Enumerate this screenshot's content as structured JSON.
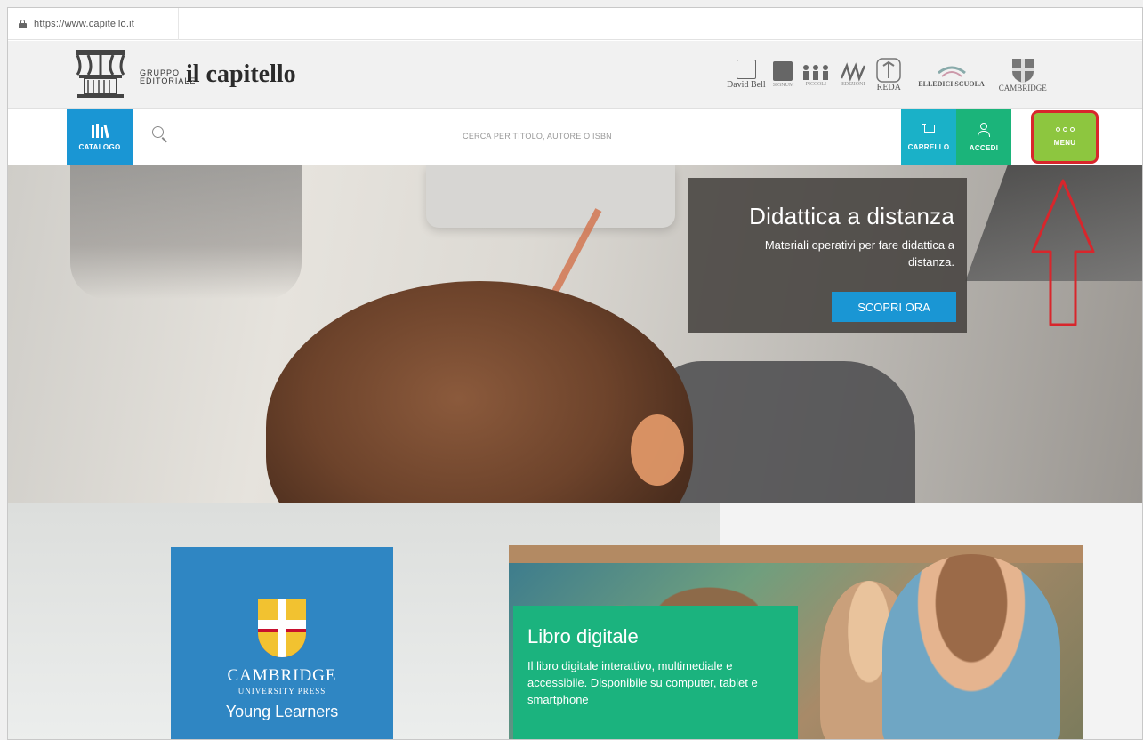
{
  "browser": {
    "url": "https://www.capitello.it"
  },
  "brand": {
    "gruppo_line1": "GRUPPO",
    "gruppo_line2": "EDITORIALE",
    "name": "il capitello",
    "partners": [
      {
        "name": "David Bell",
        "icon": "david-bell-logo"
      },
      {
        "name": "SIGNUM",
        "icon": "signum-logo"
      },
      {
        "name": "PICCOLI",
        "icon": "piccoli-logo"
      },
      {
        "name": "EDIZIONI",
        "icon": "edizioni-logo"
      },
      {
        "name": "REDA",
        "icon": "reda-logo"
      },
      {
        "name": "ELLEDICI SCUOLA",
        "icon": "elledici-logo"
      },
      {
        "name": "CAMBRIDGE",
        "icon": "cambridge-logo"
      }
    ]
  },
  "nav": {
    "catalog_label": "CATALOGO",
    "search_placeholder": "CERCA PER TITOLO, AUTORE O ISBN",
    "cart_label": "CARRELLO",
    "login_label": "ACCEDI",
    "menu_label": "MENU"
  },
  "hero": {
    "title": "Didattica a distanza",
    "text": "Materiali operativi per fare didattica a distanza.",
    "button": "SCOPRI ORA"
  },
  "cambridge": {
    "name": "CAMBRIDGE",
    "sub": "UNIVERSITY PRESS",
    "young": "Young Learners"
  },
  "libro": {
    "title": "Libro digitale",
    "text": "Il libro digitale interattivo, multimediale e accessibile. Disponibile su computer, tablet e smartphone"
  },
  "colors": {
    "catalog": "#1a96d4",
    "cart": "#1ab1c8",
    "login": "#1bb47a",
    "menu": "#8dc63f",
    "highlight": "#d8262c"
  }
}
